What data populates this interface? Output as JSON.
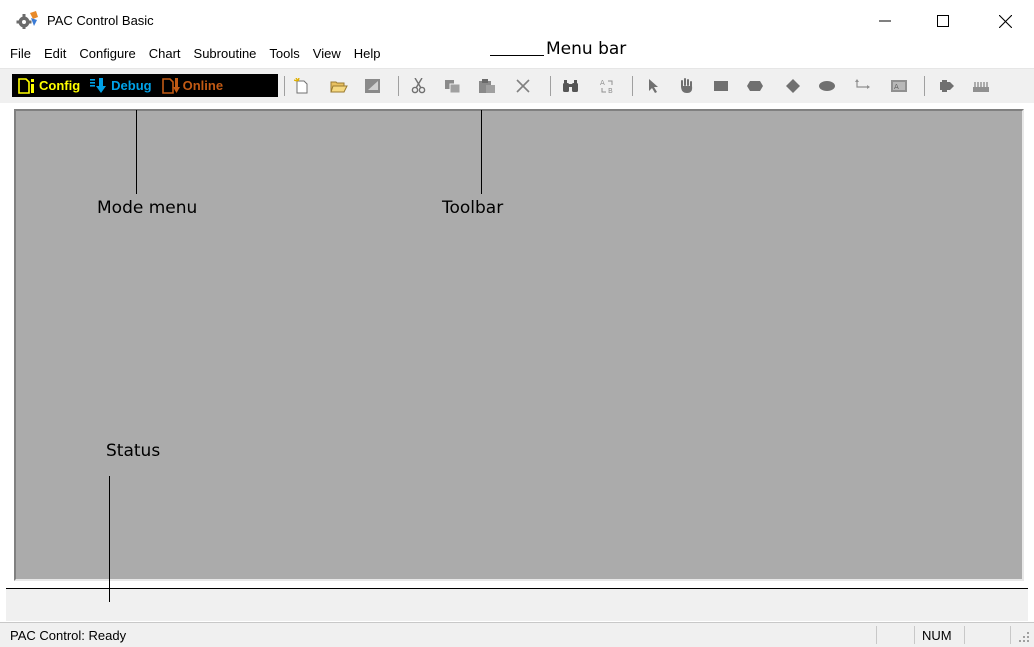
{
  "window": {
    "title": "PAC Control Basic",
    "icon": "gear-app-icon",
    "controls": {
      "minimize": "minimize-icon",
      "maximize": "maximize-icon",
      "close": "close-icon"
    }
  },
  "menu": {
    "items": [
      "File",
      "Edit",
      "Configure",
      "Chart",
      "Subroutine",
      "Tools",
      "View",
      "Help"
    ]
  },
  "mode_menu": {
    "items": [
      {
        "label": "Config",
        "color": "#ffff00",
        "icon": "config-mode-icon"
      },
      {
        "label": "Debug",
        "color": "#00a2e8",
        "icon": "debug-mode-icon"
      },
      {
        "label": "Online",
        "color": "#c25a14",
        "icon": "online-mode-icon"
      }
    ]
  },
  "toolbar": {
    "icons": [
      "new-icon",
      "open-icon",
      "save-icon",
      "cut-icon",
      "copy-icon",
      "paste-icon",
      "delete-icon",
      "find-icon",
      "replace-icon",
      "select-icon",
      "hand-icon",
      "action-block-icon",
      "condition-block-icon",
      "decision-icon",
      "continue-block-icon",
      "connect-icon",
      "text-icon",
      "zoom-icon",
      "io-icon"
    ]
  },
  "status": {
    "text": "PAC Control: Ready",
    "num": "NUM"
  },
  "callouts": {
    "menu_bar": "Menu bar",
    "mode_menu": "Mode menu",
    "toolbar": "Toolbar",
    "status": "Status"
  },
  "colors": {
    "workspace": "#ababab",
    "chrome": "#f0f0f0",
    "mode_menu_background": "#000000"
  }
}
